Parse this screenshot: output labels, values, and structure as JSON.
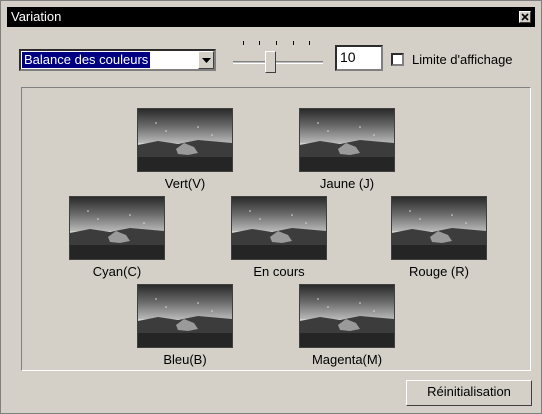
{
  "window": {
    "title": "Variation"
  },
  "controls": {
    "mode_dropdown": {
      "value": "Balance des couleurs"
    },
    "intensity_slider": {
      "level_fraction": 0.4
    },
    "intensity_value": "10",
    "display_limit": {
      "label": "Limite d'affichage",
      "checked": false
    }
  },
  "variants": [
    {
      "id": "green",
      "label": "Vert(V)"
    },
    {
      "id": "yellow",
      "label": "Jaune (J)"
    },
    {
      "id": "cyan",
      "label": "Cyan(C)"
    },
    {
      "id": "current",
      "label": "En cours"
    },
    {
      "id": "red",
      "label": "Rouge (R)"
    },
    {
      "id": "blue",
      "label": "Bleu(B)"
    },
    {
      "id": "magenta",
      "label": "Magenta(M)"
    }
  ],
  "buttons": {
    "reset_label": "Réinitialisation"
  },
  "icons": {
    "close": "close-icon",
    "dropdown_arrow": "chevron-down-icon"
  }
}
